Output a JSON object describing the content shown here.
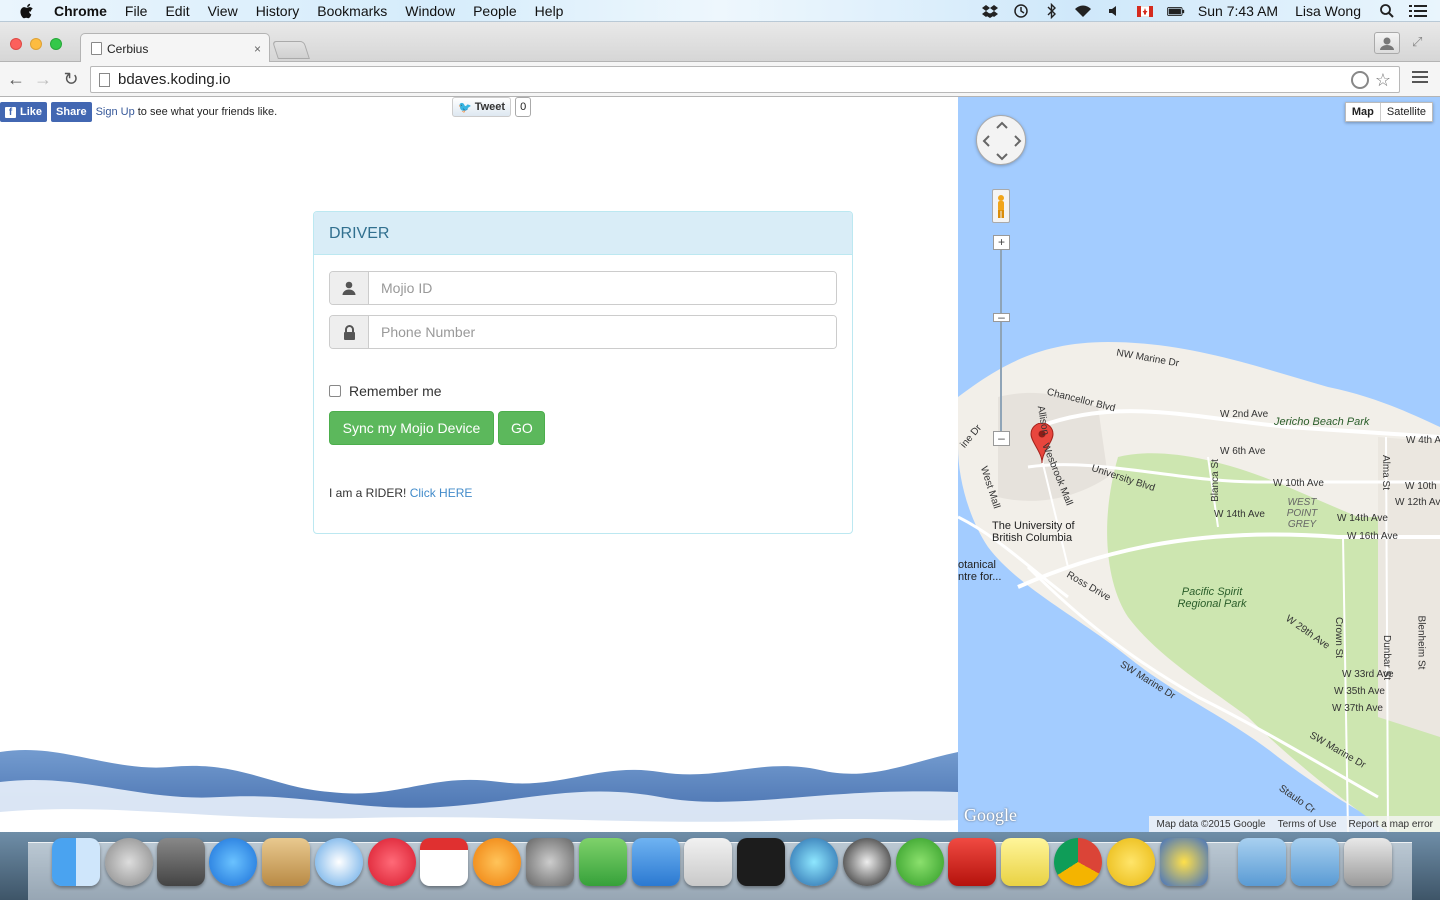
{
  "menubar": {
    "app_name": "Chrome",
    "menus": [
      "File",
      "Edit",
      "View",
      "History",
      "Bookmarks",
      "Window",
      "People",
      "Help"
    ],
    "clock": "Sun 7:43 AM",
    "user": "Lisa Wong"
  },
  "browser": {
    "tab_title": "Cerbius",
    "tab_close": "×",
    "url": "bdaves.koding.io"
  },
  "social": {
    "fb_like": "Like",
    "fb_share": "Share",
    "fb_signup": "Sign Up",
    "fb_text": "to see what your friends like.",
    "tweet_label": "Tweet",
    "tweet_count": "0"
  },
  "form": {
    "heading": "DRIVER",
    "mojo_placeholder": "Mojio ID",
    "phone_placeholder": "Phone Number",
    "remember_label": "Remember me",
    "sync_button": "Sync my Mojio Device",
    "go_button": "GO",
    "rider_text": "I am a RIDER!",
    "rider_link": "Click HERE"
  },
  "map": {
    "type_map": "Map",
    "type_satellite": "Satellite",
    "labels": {
      "nw_marine": "NW Marine Dr",
      "chancellor": "Chancellor Blvd",
      "w2nd": "W 2nd Ave",
      "jericho": "Jericho Beach Park",
      "w4th": "W 4th A",
      "w6th": "W 6th Ave",
      "university_blvd": "University Blvd",
      "w10th": "W 10th Ave",
      "w10th_right": "W 10th",
      "w12th": "W 12th Ave",
      "west_point_grey": "WEST POINT GREY",
      "w14th": "W 14th Ave",
      "w14th_right": "W 14th Ave",
      "w16th": "W 16th Ave",
      "ubc": "The University of British Columbia",
      "wesbrook": "Wesbrook Mall",
      "west_mall": "West Mall",
      "botanical": "otanical ntre for...",
      "ross": "Ross Drive",
      "pacific_spirit": "Pacific Spirit Regional Park",
      "w29th": "W 29th Ave",
      "crown": "Crown St",
      "dunbar": "Dunbar St",
      "blenheim": "Blenheim St",
      "w33rd": "W 33rd Ave",
      "w35th": "W 35th Ave",
      "w37th": "W 37th Ave",
      "sw_marine": "SW Marine Dr",
      "sw_marine2": "SW Marine Dr",
      "staulo": "Staulo Cr",
      "blanca": "Blanca St",
      "alma": "Alma St",
      "allison": "Allison",
      "ine_dr": "ine Dr"
    },
    "google": "Google",
    "footer_data": "Map data ©2015 Google",
    "footer_terms": "Terms of Use",
    "footer_report": "Report a map error"
  },
  "colors": {
    "panel_heading_bg": "#d9edf7",
    "panel_heading_text": "#31708f",
    "success": "#5cb85c",
    "link": "#428bca",
    "fb_blue": "#4267b2",
    "water": "#a3ccff"
  }
}
